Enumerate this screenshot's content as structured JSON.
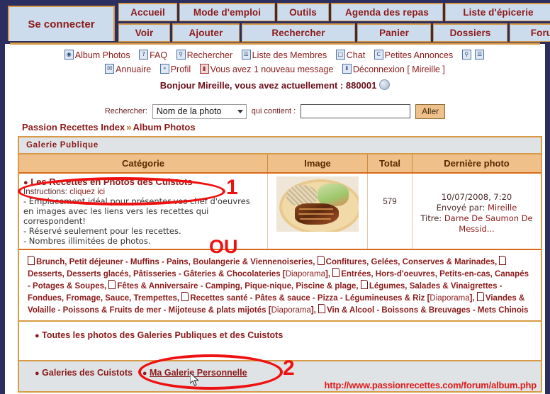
{
  "window": {
    "footer_url": "http://www.passionrecettes.com/forum/album.php"
  },
  "topnav": {
    "login_tab": "Se connecter",
    "row1": [
      {
        "label": "Accueil",
        "name": "tab-accueil"
      },
      {
        "label": "Mode d'emploi",
        "name": "tab-mode-emploi"
      },
      {
        "label": "Outils",
        "name": "tab-outils"
      },
      {
        "label": "Agenda des repas",
        "name": "tab-agenda-des-repas"
      },
      {
        "label": "Liste d'épicerie",
        "name": "tab-liste-epicerie"
      }
    ],
    "row2": [
      {
        "label": "Voir",
        "name": "tab-voir"
      },
      {
        "label": "Ajouter",
        "name": "tab-ajouter"
      },
      {
        "label": "Rechercher",
        "name": "tab-rechercher"
      },
      {
        "label": "Panier",
        "name": "tab-panier"
      },
      {
        "label": "Dossiers",
        "name": "tab-dossiers"
      },
      {
        "label": "Forum",
        "name": "tab-forum"
      }
    ]
  },
  "linkbar_row1": [
    {
      "label": "Album Photos",
      "icon": "photo-album-icon",
      "glyph": "◉"
    },
    {
      "label": "FAQ",
      "icon": "question-icon",
      "glyph": "?"
    },
    {
      "label": "Rechercher",
      "icon": "search-icon",
      "glyph": "⚲"
    },
    {
      "label": "Liste des Membres",
      "icon": "member-list-icon",
      "glyph": "☰"
    },
    {
      "label": "Chat",
      "icon": "chat-icon",
      "glyph": "□"
    },
    {
      "label": "Petites Annonces",
      "icon": "classified-ads-icon",
      "glyph": "C"
    }
  ],
  "linkbar_row1_trailing": [
    {
      "label": "",
      "icon": "search-icon",
      "glyph": "⚲"
    },
    {
      "label": "",
      "icon": "list-icon",
      "glyph": "☰"
    }
  ],
  "linkbar_row2": [
    {
      "label": "Annuaire",
      "icon": "directory-icon",
      "glyph": "☒"
    },
    {
      "label": "Profil",
      "icon": "profile-icon",
      "glyph": "⚬"
    },
    {
      "label": "Vous avez 1 nouveau message",
      "icon": "new-message-icon",
      "glyph": "▮"
    },
    {
      "label": "Déconnexion [ Mireille ]",
      "icon": "logout-icon",
      "glyph": "⬇"
    }
  ],
  "greeting": {
    "text": "Bonjour Mireille, vous avez actuellement : 880001"
  },
  "search": {
    "label": "Rechercher:",
    "selected_option": "Nom de la photo",
    "options": [
      "Nom de la photo"
    ],
    "contains_label": "qui contient :",
    "input_value": "",
    "input_placeholder": "",
    "go_label": "Aller"
  },
  "breadcrumb": {
    "root": "Passion Recettes Index",
    "arrows": "»",
    "current": "Album Photos"
  },
  "gallery": {
    "section_title": "Galerie Publique",
    "columns": [
      "Catégorie",
      "Image",
      "Total",
      "Dernière photo"
    ],
    "row": {
      "category_title": "Les Recettes en Photos des Cuistots",
      "instructions_label": "Instructions:",
      "instructions_link": "cliquez ici",
      "description_lines": [
        "- Emplacement idéal pour présenter vos chef d'oeuvres",
        "en images avec les liens vers les recettes qui",
        "correspondent!",
        "- Réservé seulement pour les recettes.",
        "- Nombres illimitées de photos."
      ],
      "total": "579",
      "last_photo_date": "10/07/2008, 7:20",
      "last_photo_sender_label": "Envoyé par:",
      "last_photo_sender": "Mireille",
      "last_photo_title_label": "Titre:",
      "last_photo_title": "Darne De Saumon De Messid..."
    }
  },
  "category_links": {
    "items": [
      "Brunch, Petit déjeuner - Muffins - Pains, Boulangerie & Viennenoiseries",
      "Confitures, Gelées, Conserves & Marinades",
      "Desserts, Desserts glacés, Pâtisseries - Gâteries & Chocolateries",
      "Entrées, Hors-d'oeuvres, Petits-en-cas, Canapés - Potages & Soupes",
      "Fêtes & Anniversaire - Camping, Pique-nique, Piscine & plage",
      "Légumes, Salades & Vinaigrettes - Fondues, Fromage, Sauce, Trempettes",
      "Recettes santé - Pâtes & sauce - Pizza - Légumineuses & Riz",
      "Viandes & Volaille - Poissons & Fruits de mer - Mijoteuse & plats mijotés",
      "Vin & Alcool - Boissons & Breuvages - Mets Chinois"
    ],
    "diaporama_label": "Diaporama",
    "separator": ","
  },
  "bottom": {
    "all_photos": "Toutes les photos des Galeries Publiques et des Cuistots",
    "galleries_label": "Galeries des Cuistots",
    "personal_gallery": "Ma Galerie Personnelle"
  },
  "annotations": {
    "mark1": "1",
    "mark2": "2",
    "or_text": "OU",
    "color": "#ee1111"
  }
}
